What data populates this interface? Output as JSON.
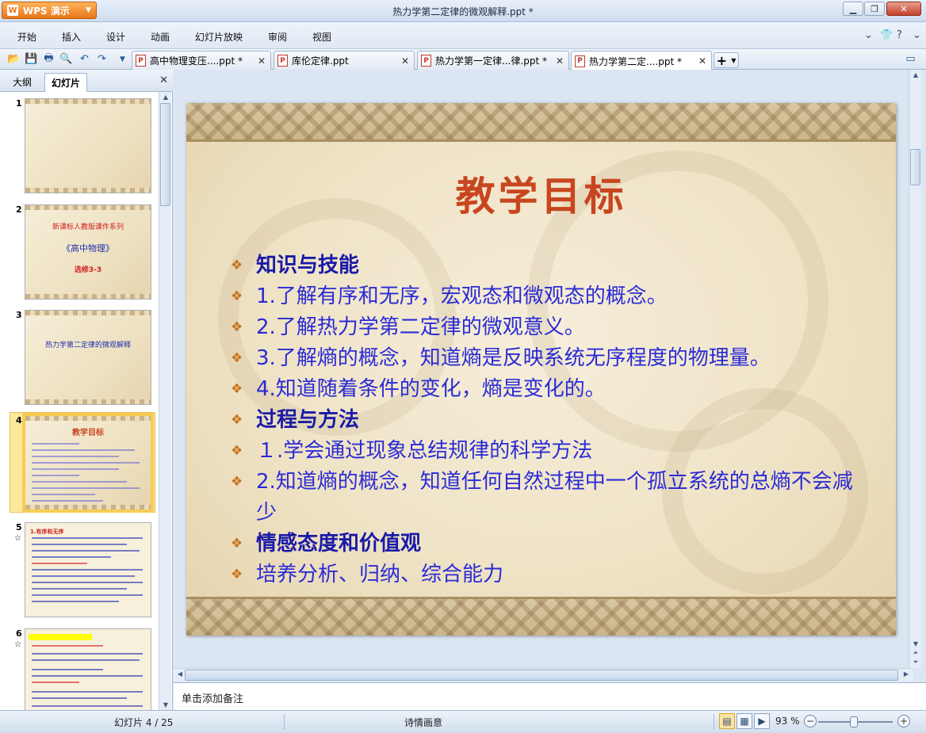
{
  "app": {
    "menu_label": "WPS 演示",
    "window_title": "热力学第二定律的微观解释.ppt *"
  },
  "menubar": {
    "items": [
      "开始",
      "插入",
      "设计",
      "动画",
      "幻灯片放映",
      "审阅",
      "视图"
    ]
  },
  "doc_tabs": [
    {
      "label": "高中物理变压....ppt *",
      "active": false
    },
    {
      "label": "库伦定律.ppt",
      "active": false
    },
    {
      "label": "热力学第一定律...律.ppt *",
      "active": false
    },
    {
      "label": "热力学第二定....ppt *",
      "active": true
    }
  ],
  "left_panel": {
    "tabs": [
      "大纲",
      "幻灯片"
    ],
    "active_tab": "幻灯片",
    "thumbnails": [
      {
        "num": "1",
        "lines": []
      },
      {
        "num": "2",
        "lines": [
          "新课标人教版课件系列",
          "《高中物理》",
          "选修3-3"
        ]
      },
      {
        "num": "3",
        "lines": [
          "热力学第二定律的微观解释"
        ]
      },
      {
        "num": "4",
        "lines": [
          "教学目标"
        ],
        "selected": true
      },
      {
        "num": "5",
        "lines": [
          "1.有序和无序"
        ],
        "star": "☆"
      },
      {
        "num": "6",
        "lines": [],
        "star": "☆"
      }
    ]
  },
  "slide": {
    "title": "教学目标",
    "bullets": [
      {
        "text": "知识与技能",
        "heading": true
      },
      {
        "text": "1.了解有序和无序，宏观态和微观态的概念。"
      },
      {
        "text": "2.了解热力学第二定律的微观意义。"
      },
      {
        "text": "3.了解熵的概念，知道熵是反映系统无序程度的物理量。"
      },
      {
        "text": "4.知道随着条件的变化，熵是变化的。"
      },
      {
        "text": "过程与方法",
        "heading": true
      },
      {
        "text": "１.学会通过现象总结规律的科学方法"
      },
      {
        "text": "2.知道熵的概念，知道任何自然过程中一个孤立系统的总熵不会减少"
      },
      {
        "text": "情感态度和价值观",
        "heading": true
      },
      {
        "text": "培养分析、归纳、综合能力"
      }
    ]
  },
  "notes": {
    "placeholder": "单击添加备注"
  },
  "status": {
    "slide_info": "幻灯片 4 / 25",
    "theme": "诗情画意",
    "zoom": "93 %"
  },
  "colors": {
    "title": "#c8461f",
    "bullet_text": "#2b2bd6",
    "bullet_marker": "#c8741e",
    "accent_orange": "#e8761a"
  }
}
